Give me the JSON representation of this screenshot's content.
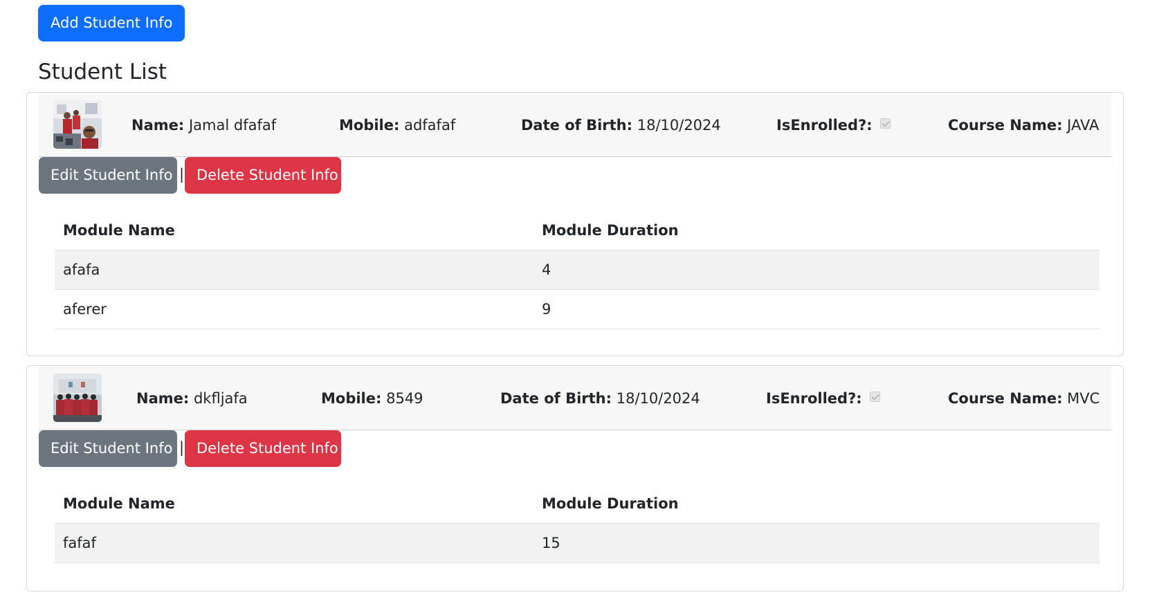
{
  "toolbar": {
    "add_label": "Add Student Info"
  },
  "page": {
    "title": "Student List"
  },
  "labels": {
    "name": "Name:",
    "mobile": "Mobile:",
    "dob": "Date of Birth:",
    "enrolled": "IsEnrolled?:",
    "course": "Course Name:",
    "edit": "Edit Student Info",
    "separator": "|",
    "delete": "Delete Student Info",
    "module_name": "Module Name",
    "module_duration": "Module Duration"
  },
  "students": [
    {
      "name": "Jamal dfafaf",
      "mobile": "adfafaf",
      "dob": "18/10/2024",
      "is_enrolled": true,
      "course": "JAVA",
      "modules": [
        {
          "name": "afafa",
          "duration": "4"
        },
        {
          "name": "aferer",
          "duration": "9"
        }
      ]
    },
    {
      "name": "dkfljafa",
      "mobile": "8549",
      "dob": "18/10/2024",
      "is_enrolled": true,
      "course": "MVC",
      "modules": [
        {
          "name": "fafaf",
          "duration": "15"
        }
      ]
    }
  ]
}
